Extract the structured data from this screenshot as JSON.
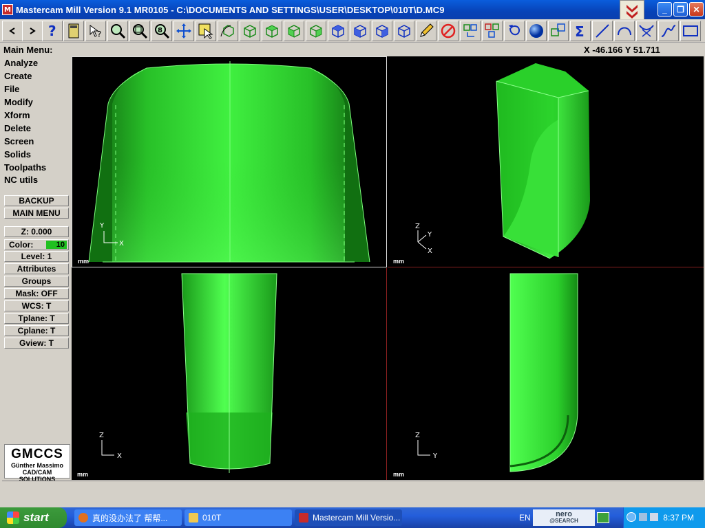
{
  "window": {
    "title": "Mastercam Mill Version 9.1 MR0105 - C:\\DOCUMENTS AND SETTINGS\\USER\\DESKTOP\\010T\\D.MC9",
    "icon_text": "M",
    "minimize": "_",
    "maximize": "❐",
    "close": "✕"
  },
  "status": {
    "main_menu_label": "Main Menu:",
    "coordinates": "X -46.166  Y 51.711"
  },
  "menu": {
    "items": [
      "Analyze",
      "Create",
      "File",
      "Modify",
      "Xform",
      "Delete",
      "Screen",
      "Solids",
      "Toolpaths",
      "NC utils"
    ],
    "backup": "BACKUP",
    "main_menu": "MAIN MENU",
    "z": "Z:   0.000",
    "color_label": "Color:",
    "color_value": "10",
    "level": "Level:   1",
    "attributes": "Attributes",
    "groups": "Groups",
    "mask": "Mask:  OFF",
    "wcs": "WCS:   T",
    "tplane": "Tplane:  T",
    "cplane": "Cplane:  T",
    "gview": "Gview:  T"
  },
  "logo": {
    "main": "GMCCS",
    "line1": "Günther Massimo",
    "line2": "CAD/CAM SOLUTIONS"
  },
  "viewports": {
    "units": "mm",
    "top_view_axes": [
      "Y",
      "X"
    ],
    "iso_view_axes": [
      "Z",
      "Y",
      "X"
    ],
    "front_view_axes": [
      "Z",
      "X"
    ],
    "side_view_axes": [
      "Z",
      "Y"
    ]
  },
  "taskbar": {
    "start": "start",
    "tasks": [
      {
        "label": "真的没办法了 帮帮..."
      },
      {
        "label": "010T"
      },
      {
        "label": "Mastercam Mill Versio..."
      }
    ],
    "language": "EN",
    "nero_line1": "nero",
    "nero_line2": "@SEARCH",
    "clock": "8:37 PM"
  },
  "colors": {
    "model_green": "#22e022",
    "viewport_bg": "#000000",
    "titlebar_blue": "#0a5ddc",
    "taskbar_blue": "#245edb"
  }
}
